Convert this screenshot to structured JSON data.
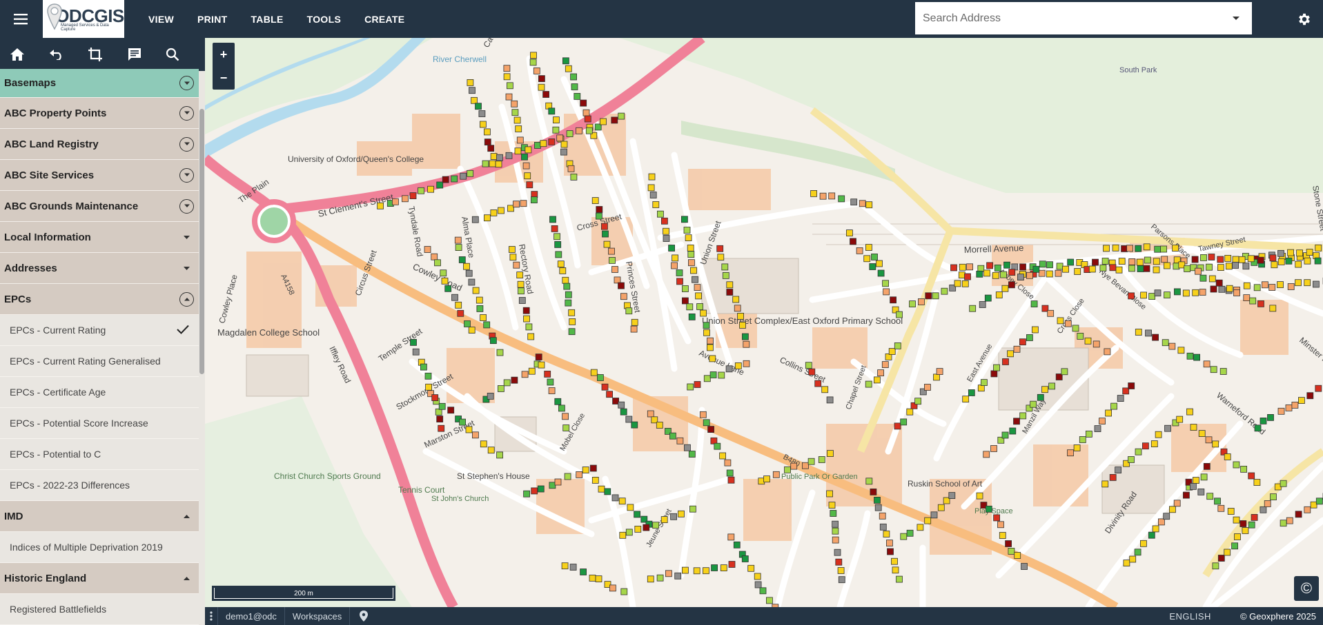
{
  "topbar": {
    "logo_text": "ODCGIS",
    "logo_sub": "Managed Services & Data Capture",
    "menu": [
      "VIEW",
      "PRINT",
      "TABLE",
      "TOOLS",
      "CREATE"
    ],
    "search_placeholder": "Search Address"
  },
  "sidebar": {
    "layers": [
      {
        "type": "group",
        "label": "Basemaps",
        "state": "active"
      },
      {
        "type": "group",
        "label": "ABC Property Points"
      },
      {
        "type": "group",
        "label": "ABC Land Registry"
      },
      {
        "type": "group",
        "label": "ABC Site Services"
      },
      {
        "type": "group",
        "label": "ABC Grounds Maintenance"
      },
      {
        "type": "group",
        "label": "Local Information"
      },
      {
        "type": "group",
        "label": "Addresses"
      },
      {
        "type": "group",
        "label": "EPCs"
      },
      {
        "type": "item",
        "label": "EPCs - Current Rating",
        "checked": true
      },
      {
        "type": "item",
        "label": "EPCs - Current Rating Generalised"
      },
      {
        "type": "item",
        "label": "EPCs - Certificate Age"
      },
      {
        "type": "item",
        "label": "EPCs - Potential Score Increase"
      },
      {
        "type": "item",
        "label": "EPCs - Potential to C"
      },
      {
        "type": "item",
        "label": "EPCs - 2022-23 Differences"
      },
      {
        "type": "group",
        "label": "IMD"
      },
      {
        "type": "item",
        "label": "Indices of Multiple Deprivation 2019"
      },
      {
        "type": "group",
        "label": "Historic England"
      },
      {
        "type": "item",
        "label": "Registered Battlefields"
      }
    ]
  },
  "map": {
    "zoom_in": "+",
    "zoom_out": "−",
    "scale_label": "200 m",
    "attribution_symbol": "©",
    "labels": [
      "River Cherwell",
      "South Park",
      "University of Oxford/Queen's College",
      "The Plain",
      "St Clement's Street",
      "Cross Street",
      "Morrell Avenue",
      "Cowley Road",
      "Cowley Place",
      "Magdalen College School",
      "Iffley Road",
      "Union Street Complex/East Oxford Primary School",
      "Avenue Lane",
      "Collins Street",
      "Christ Church Sports Ground",
      "Tennis Court",
      "St Stephen's House",
      "St John's Church",
      "Public Park Or Garden",
      "Play Space",
      "Ruskin School of Art",
      "Rectory Road",
      "Princes Street",
      "Union Street",
      "Temple Street",
      "Stockmore Street",
      "Marston Street",
      "Tawney Street",
      "Parsons Place",
      "Abbey Close",
      "Cross Close",
      "Nye Bevan Close",
      "East Avenue",
      "Manzil Way",
      "Divinity Road",
      "Warneford Road",
      "Stone Street",
      "Minster Road",
      "Circus Street",
      "Alma Place",
      "Tyndale Road",
      "Cave Street",
      "B480",
      "A4158",
      "Chapel Street",
      "Mobel Close",
      "Jeune Street"
    ]
  },
  "statusbar": {
    "user": "demo1@odc",
    "workspaces": "Workspaces",
    "language": "ENGLISH",
    "copyright": "© Geoxphere 2025"
  },
  "colors": {
    "header_bg": "#243444",
    "active_group": "#8ecab8",
    "group_bg": "#d5cbc2",
    "item_bg": "#e9e6e1",
    "major_road": "#f08198",
    "b_road": "#f7c087",
    "epc_dark_green": "#1a9641",
    "epc_green": "#52b848",
    "epc_light_green": "#a6d64a",
    "epc_yellow": "#f7d11b",
    "epc_orange": "#f4a36a",
    "epc_red": "#d7301f",
    "epc_dark_red": "#8b0a0a",
    "epc_grey": "#8c8c8c"
  },
  "icons": [
    "menu-icon",
    "home-icon",
    "undo-icon",
    "crop-icon",
    "comment-icon",
    "search-icon",
    "settings-icon",
    "chevron-down-icon",
    "check-icon",
    "location-pin-icon",
    "more-vert-icon"
  ]
}
